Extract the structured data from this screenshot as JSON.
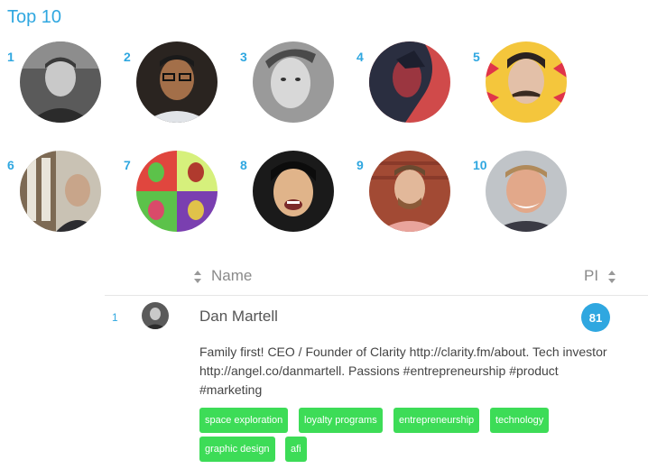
{
  "title": "Top 10",
  "top_list": [
    {
      "rank": "1"
    },
    {
      "rank": "2"
    },
    {
      "rank": "3"
    },
    {
      "rank": "4"
    },
    {
      "rank": "5"
    },
    {
      "rank": "6"
    },
    {
      "rank": "7"
    },
    {
      "rank": "8"
    },
    {
      "rank": "9"
    },
    {
      "rank": "10"
    }
  ],
  "table": {
    "header_name": "Name",
    "header_pi": "PI",
    "row": {
      "rank": "1",
      "name": "Dan Martell",
      "pi": "81",
      "bio": "Family first! CEO / Founder of Clarity http://clarity.fm/about. Tech investor http://angel.co/danmartell. Passions #entrepreneurship #product #marketing",
      "tags": [
        "space exploration",
        "loyalty programs",
        "entrepreneurship",
        "technology",
        "graphic design",
        "afi"
      ]
    }
  },
  "colors": {
    "accent": "#2fa7e0",
    "tag": "#3ddc57"
  }
}
